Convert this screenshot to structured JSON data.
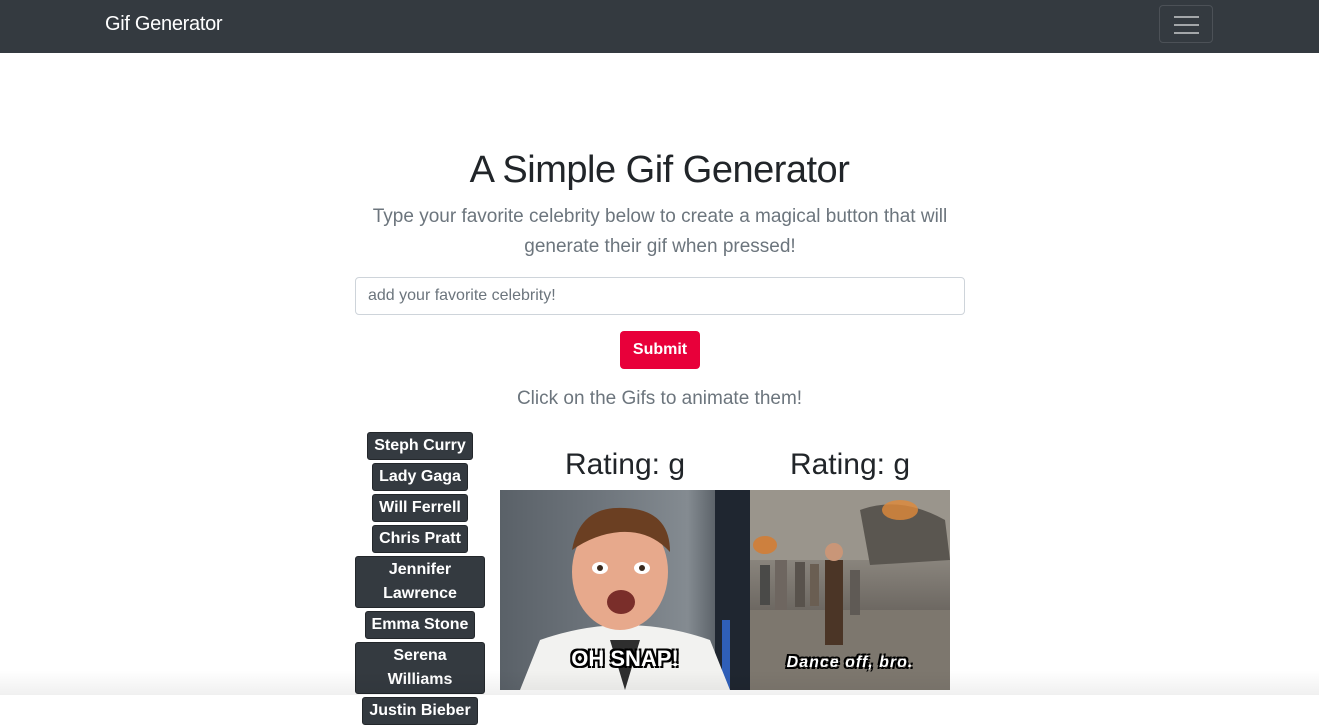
{
  "navbar": {
    "brand": "Gif Generator",
    "toggler_icon": "hamburger-menu-icon"
  },
  "main": {
    "title": "A Simple Gif Generator",
    "lead": "Type your favorite celebrity below to create a magical button that will generate their gif when pressed!",
    "search": {
      "placeholder": "add your favorite celebrity!",
      "value": ""
    },
    "submit_label": "Submit",
    "hint": "Click on the Gifs to animate them!"
  },
  "celebrities": [
    "Steph Curry",
    "Lady Gaga",
    "Will Ferrell",
    "Chris Pratt",
    "Jennifer Lawrence",
    "Emma Stone",
    "Serena Williams",
    "Justin Bieber"
  ],
  "gifs": [
    {
      "rating": "Rating: g",
      "caption": "OH SNAP!"
    },
    {
      "rating": "Rating: g",
      "caption": "Dance off, bro."
    }
  ],
  "colors": {
    "navbar": "#343a40",
    "submit": "#e8003a",
    "celeb_button": "#343a40"
  }
}
